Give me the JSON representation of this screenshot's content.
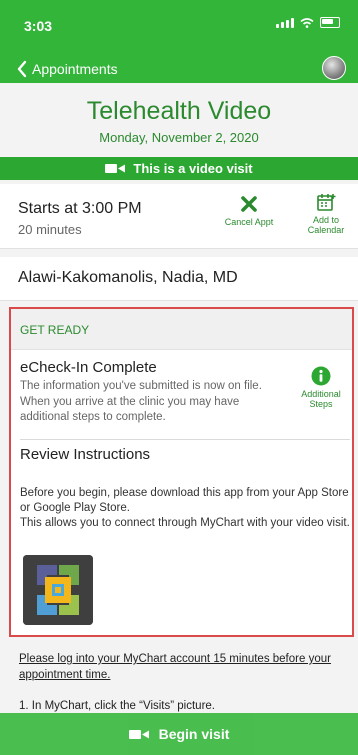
{
  "status_bar": {
    "time": "3:03"
  },
  "nav": {
    "back_label": "Appointments"
  },
  "header": {
    "title": "Telehealth Video",
    "date": "Monday, November 2, 2020"
  },
  "banner": {
    "text": "This is a video visit"
  },
  "appointment": {
    "starts": "Starts at 3:00 PM",
    "duration": "20 minutes",
    "cancel_label": "Cancel Appt",
    "add_calendar_label": "Add to Calendar",
    "provider": "Alawi-Kakomanolis, Nadia, MD"
  },
  "get_ready": {
    "heading": "GET READY",
    "echeck_title": "eCheck-In Complete",
    "echeck_body": "The information you've submitted is now on file. When you arrive at the clinic you may have additional steps to complete.",
    "additional_steps_label": "Additional Steps",
    "review_title": "Review Instructions",
    "review_body": "Before you begin, please download this app from your App Store or Google Play Store.\nThis allows you to connect through MyChart with your video visit."
  },
  "instructions": {
    "login_note": "Please log into your MyChart account 15 minutes before your appointment time.",
    "step1": "1.  In MyChart, click the “Visits” picture."
  },
  "footer": {
    "begin_label": "Begin visit"
  },
  "colors": {
    "brand_green": "#33b53a",
    "text_green": "#2b8a2f",
    "highlight_red": "#d94b4b"
  },
  "icons": [
    "back-chevron-icon",
    "avatar",
    "video-camera-icon",
    "cancel-x-icon",
    "calendar-add-icon",
    "info-icon",
    "app-logo-icon"
  ]
}
